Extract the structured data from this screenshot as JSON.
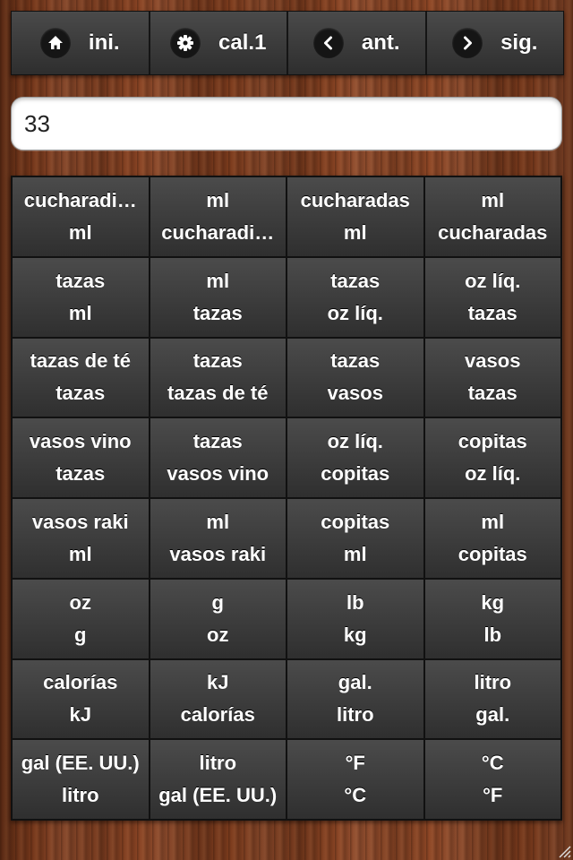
{
  "toolbar": {
    "buttons": [
      {
        "label": "ini.",
        "icon": "home-icon"
      },
      {
        "label": "cal.1",
        "icon": "gear-icon"
      },
      {
        "label": "ant.",
        "icon": "chevron-left-icon"
      },
      {
        "label": "sig.",
        "icon": "chevron-right-icon"
      }
    ]
  },
  "input": {
    "value": "33"
  },
  "grid": [
    [
      {
        "top": "cucharadi…",
        "bottom": "ml"
      },
      {
        "top": "ml",
        "bottom": "cucharadi…"
      },
      {
        "top": "cucharadas",
        "bottom": "ml"
      },
      {
        "top": "ml",
        "bottom": "cucharadas"
      }
    ],
    [
      {
        "top": "tazas",
        "bottom": "ml"
      },
      {
        "top": "ml",
        "bottom": "tazas"
      },
      {
        "top": "tazas",
        "bottom": "oz líq."
      },
      {
        "top": "oz líq.",
        "bottom": "tazas"
      }
    ],
    [
      {
        "top": "tazas de té",
        "bottom": "tazas"
      },
      {
        "top": "tazas",
        "bottom": "tazas de té"
      },
      {
        "top": "tazas",
        "bottom": "vasos"
      },
      {
        "top": "vasos",
        "bottom": "tazas"
      }
    ],
    [
      {
        "top": "vasos vino",
        "bottom": "tazas"
      },
      {
        "top": "tazas",
        "bottom": "vasos vino"
      },
      {
        "top": "oz líq.",
        "bottom": "copitas"
      },
      {
        "top": "copitas",
        "bottom": "oz líq."
      }
    ],
    [
      {
        "top": "vasos raki",
        "bottom": "ml"
      },
      {
        "top": "ml",
        "bottom": "vasos raki"
      },
      {
        "top": "copitas",
        "bottom": "ml"
      },
      {
        "top": "ml",
        "bottom": "copitas"
      }
    ],
    [
      {
        "top": "oz",
        "bottom": "g"
      },
      {
        "top": "g",
        "bottom": "oz"
      },
      {
        "top": "lb",
        "bottom": "kg"
      },
      {
        "top": "kg",
        "bottom": "lb"
      }
    ],
    [
      {
        "top": "calorías",
        "bottom": "kJ"
      },
      {
        "top": "kJ",
        "bottom": "calorías"
      },
      {
        "top": "gal.",
        "bottom": "litro"
      },
      {
        "top": "litro",
        "bottom": "gal."
      }
    ],
    [
      {
        "top": "gal (EE. UU.)",
        "bottom": "litro"
      },
      {
        "top": "litro",
        "bottom": "gal (EE. UU.)"
      },
      {
        "top": "°F",
        "bottom": "°C"
      },
      {
        "top": "°C",
        "bottom": "°F"
      }
    ]
  ]
}
